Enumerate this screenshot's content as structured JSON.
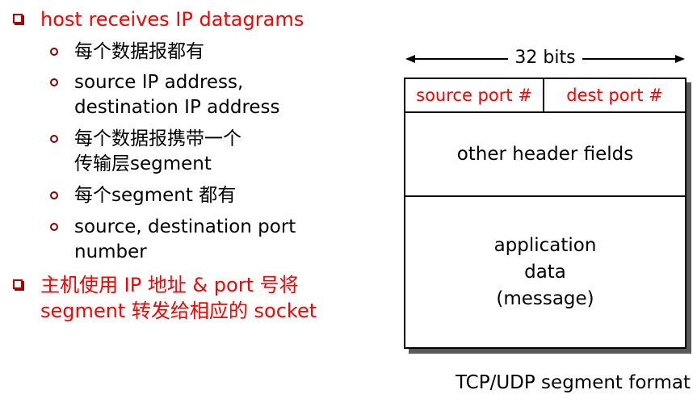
{
  "bullets": [
    {
      "level": 1,
      "lines": [
        "host receives IP datagrams"
      ]
    },
    {
      "level": 2,
      "lines": [
        "每个数据报都有"
      ]
    },
    {
      "level": 2,
      "lines": [
        " source IP address,",
        "destination IP address"
      ]
    },
    {
      "level": 2,
      "lines": [
        "每个数据报携带一个",
        "传输层segment"
      ]
    },
    {
      "level": 2,
      "lines": [
        "每个segment 都有"
      ]
    },
    {
      "level": 2,
      "lines": [
        "source, destination port",
        "number"
      ]
    },
    {
      "level": 1,
      "lines": [
        "主机使用 IP 地址 & port 号将",
        "segment 转发给相应的 socket"
      ]
    }
  ],
  "diagram": {
    "width_label": "32 bits",
    "source_port": "source port #",
    "dest_port": "dest port #",
    "header_fields": "other header fields",
    "data_lines": [
      "application",
      "data",
      "(message)"
    ],
    "caption": "TCP/UDP segment format"
  },
  "colors": {
    "accent": "#ff0000",
    "text": "#000000"
  }
}
